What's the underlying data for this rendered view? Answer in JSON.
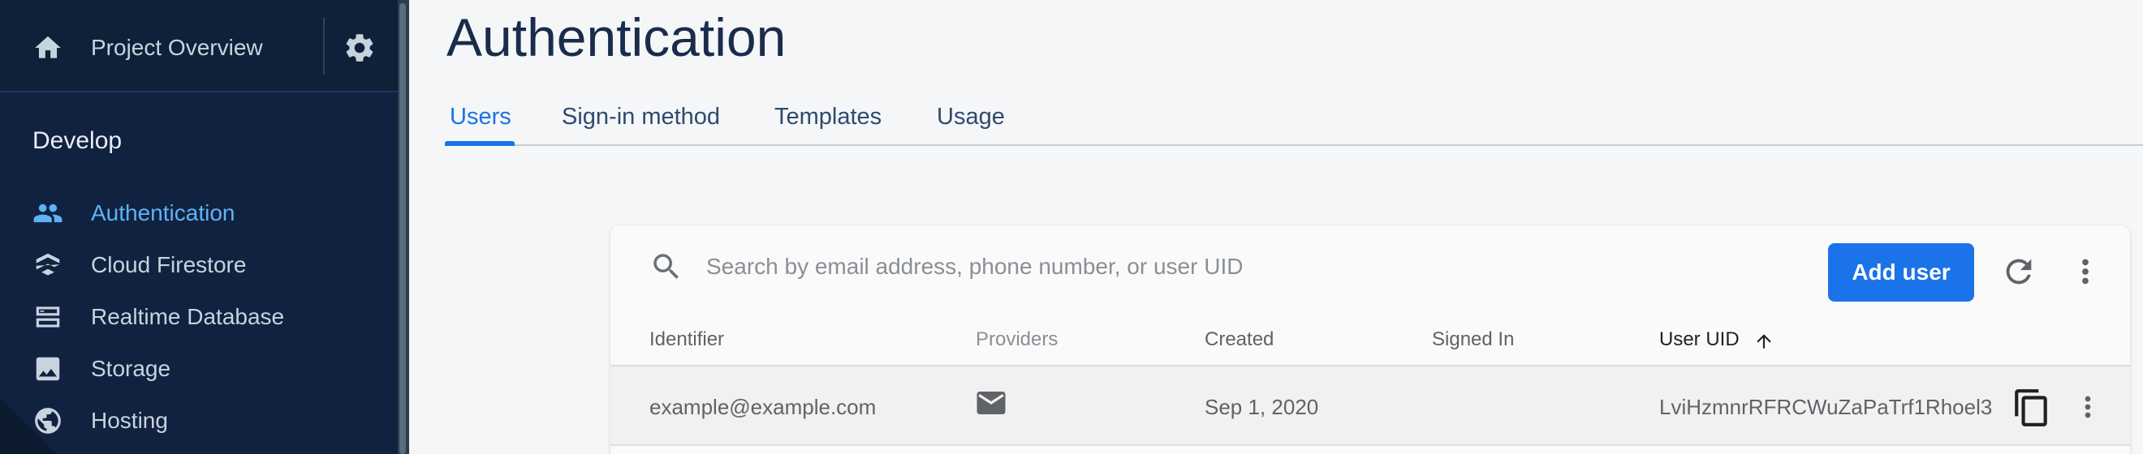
{
  "sidebar": {
    "project_label": "Project Overview",
    "section_title": "Develop",
    "items": [
      {
        "label": "Authentication",
        "icon": "people-icon",
        "active": true
      },
      {
        "label": "Cloud Firestore",
        "icon": "firestore-icon",
        "active": false
      },
      {
        "label": "Realtime Database",
        "icon": "database-icon",
        "active": false
      },
      {
        "label": "Storage",
        "icon": "image-icon",
        "active": false
      },
      {
        "label": "Hosting",
        "icon": "globe-icon",
        "active": false
      }
    ]
  },
  "header": {
    "title": "Authentication",
    "tabs": [
      {
        "label": "Users",
        "active": true
      },
      {
        "label": "Sign-in method",
        "active": false
      },
      {
        "label": "Templates",
        "active": false
      },
      {
        "label": "Usage",
        "active": false
      }
    ]
  },
  "users_table": {
    "search": {
      "value": "",
      "placeholder": "Search by email address, phone number, or user UID"
    },
    "add_user_label": "Add user",
    "columns": [
      "Identifier",
      "Providers",
      "Created",
      "Signed In",
      "User UID"
    ],
    "sort_column": "User UID",
    "rows": [
      {
        "identifier": "example@example.com",
        "provider": "email-icon",
        "created": "Sep 1, 2020",
        "signed_in": "",
        "uid": "LviHzmnrRFRCWuZaPaTrf1Rhoel3"
      }
    ]
  },
  "colors": {
    "sidebar_bg": "#112240",
    "accent": "#1a73e8",
    "active_nav": "#5eb3f5",
    "title": "#1a2c4b"
  }
}
